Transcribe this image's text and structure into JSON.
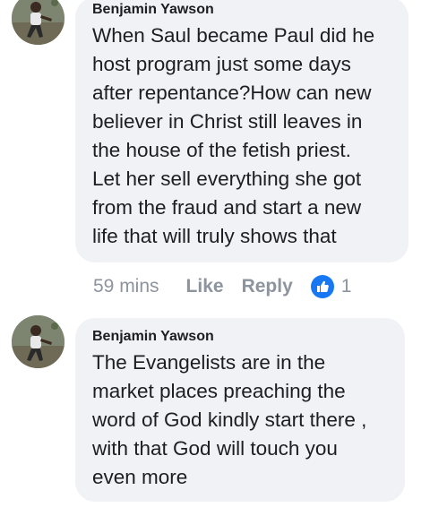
{
  "comments": [
    {
      "author": "Benjamin Yawson",
      "text": "When Saul became Paul did he\nhost program just some days\nafter repentance?How can new\nbeliever in Christ still leaves in\nthe house of the fetish priest.\nLet her sell everything she  got\nfrom the fraud and start a new\nlife that will truly shows that",
      "time": "59 mins",
      "like_label": "Like",
      "reply_label": "Reply",
      "reaction_count": "1",
      "reaction_icon": "like-thumbs-up-icon",
      "reaction_color": "#1877f2"
    },
    {
      "author": "Benjamin Yawson",
      "text": "The Evangelists are in the\nmarket places preaching the\nword of God kindly start there ,\nwith that God will touch you\neven more"
    }
  ]
}
